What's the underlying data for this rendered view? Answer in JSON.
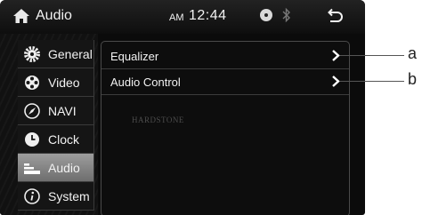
{
  "header": {
    "title": "Audio",
    "ampm": "AM",
    "time": "12:44"
  },
  "sidebar": {
    "items": [
      {
        "label": "General",
        "icon": "gear-icon",
        "active": false
      },
      {
        "label": "Video",
        "icon": "film-reel-icon",
        "active": false
      },
      {
        "label": "NAVI",
        "icon": "compass-icon",
        "active": false
      },
      {
        "label": "Clock",
        "icon": "clock-icon",
        "active": false
      },
      {
        "label": "Audio",
        "icon": "equalizer-bars-icon",
        "active": true
      },
      {
        "label": "System",
        "icon": "info-icon",
        "active": false
      }
    ]
  },
  "main": {
    "rows": [
      {
        "label": "Equalizer"
      },
      {
        "label": "Audio Control"
      }
    ],
    "watermark": "HARDSTONE"
  },
  "callouts": {
    "a": "a",
    "b": "b"
  },
  "colors": {
    "background": "#0b0b0b",
    "text": "#f2f2f2",
    "active_item": "#8a8a8a"
  }
}
